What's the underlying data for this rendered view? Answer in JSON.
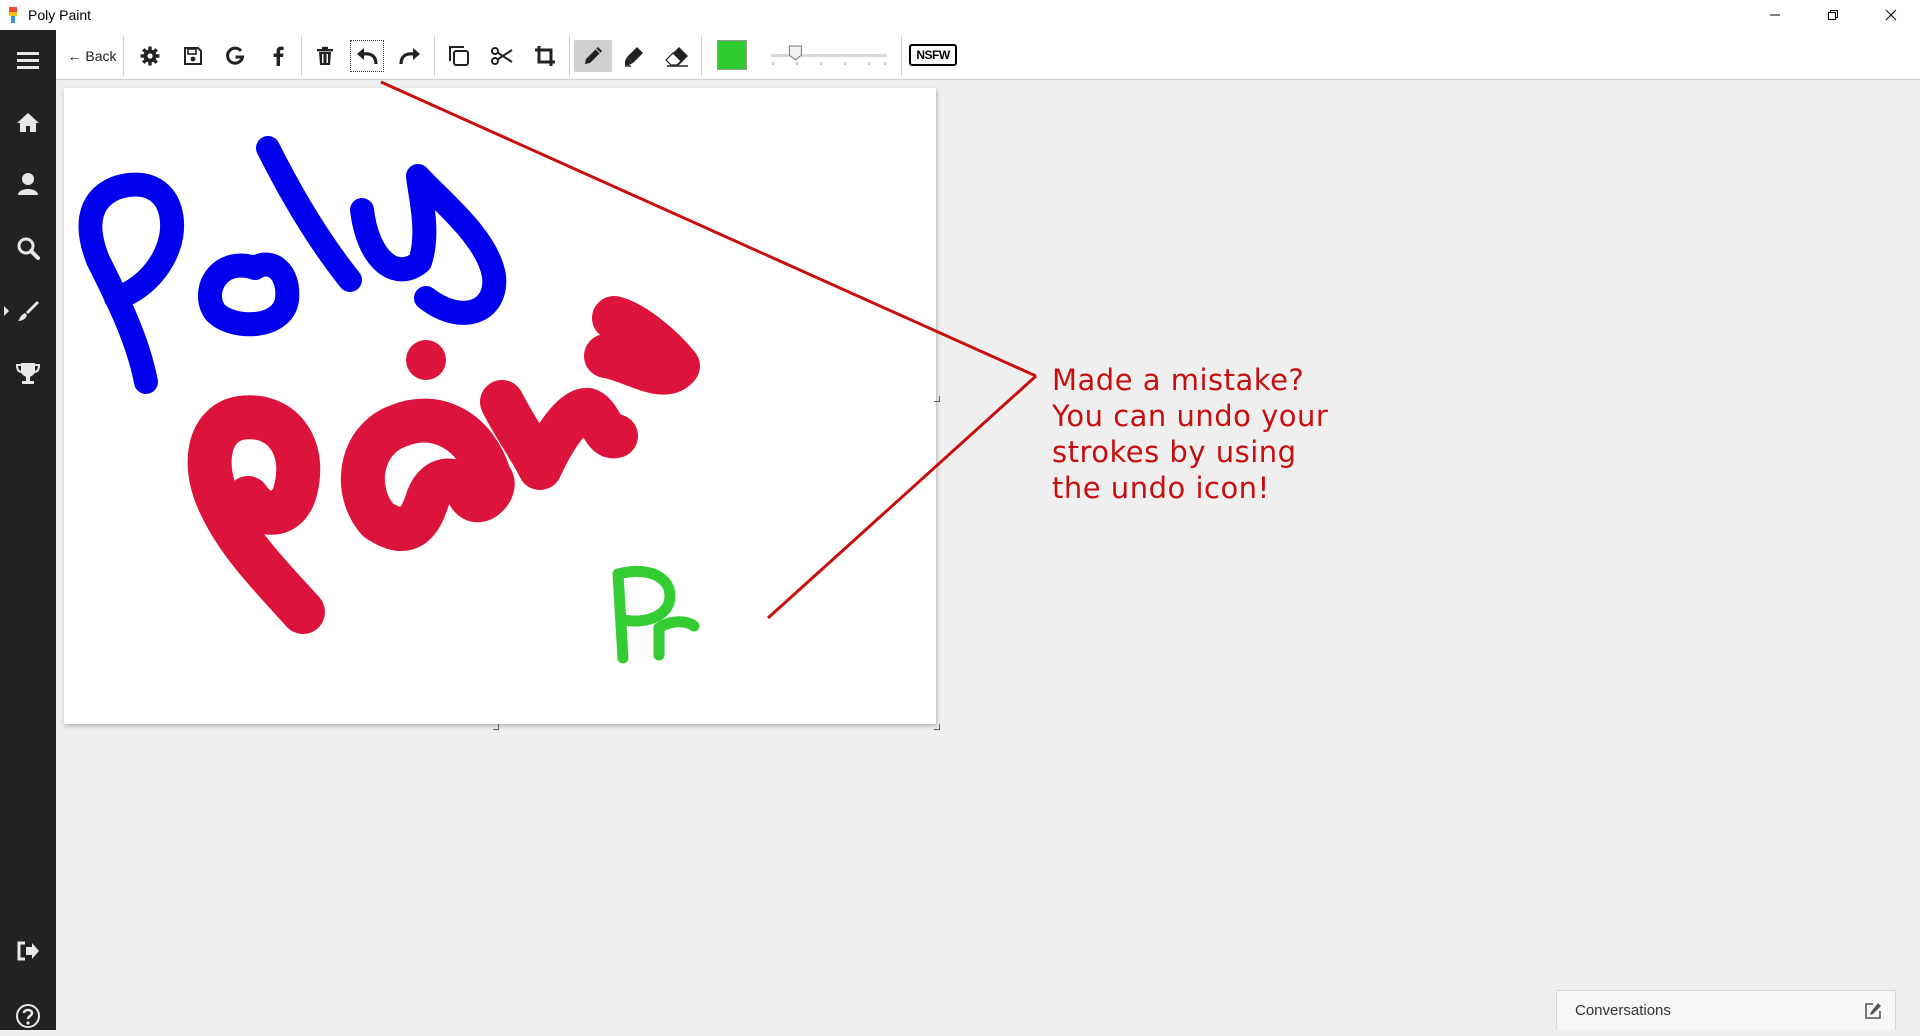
{
  "window": {
    "title": "Poly Paint",
    "controls": [
      "minimize-icon",
      "restore-icon",
      "close-icon"
    ]
  },
  "sidebar": {
    "items": [
      {
        "name": "menu",
        "icon": "hamburger-menu-icon"
      },
      {
        "name": "home",
        "icon": "home-icon"
      },
      {
        "name": "profile",
        "icon": "user-icon"
      },
      {
        "name": "search",
        "icon": "search-icon"
      },
      {
        "name": "paint",
        "icon": "brush-icon",
        "active": true
      },
      {
        "name": "leaderboard",
        "icon": "trophy-icon"
      },
      {
        "name": "logout",
        "icon": "sign-out-icon"
      },
      {
        "name": "help",
        "icon": "help-icon"
      }
    ]
  },
  "toolbar": {
    "back_label": "← Back",
    "tools": [
      "settings-icon",
      "save-icon",
      "google-icon",
      "facebook-icon",
      "trash-icon",
      "undo-icon",
      "redo-icon",
      "duplicate-icon",
      "cut-icon",
      "crop-icon",
      "pencil-icon",
      "marker-icon",
      "eraser-icon"
    ],
    "active_tool": "pencil",
    "focused_tool": "undo",
    "color": "#2ecc2e",
    "thickness_fraction": 0.2,
    "nsfw_label": "NSFW"
  },
  "canvas": {
    "strokes": [
      {
        "text": "Poly",
        "color": "#0000ee"
      },
      {
        "text": "Paint",
        "color": "#dc143c"
      },
      {
        "text": "Pr",
        "color": "#33cc33"
      }
    ]
  },
  "callout": {
    "lines": [
      "Made a mistake?",
      "You can undo your",
      "strokes by using",
      "the undo icon!"
    ],
    "color": "#c80f0f"
  },
  "conversations": {
    "label": "Conversations",
    "icon": "edit-icon"
  }
}
